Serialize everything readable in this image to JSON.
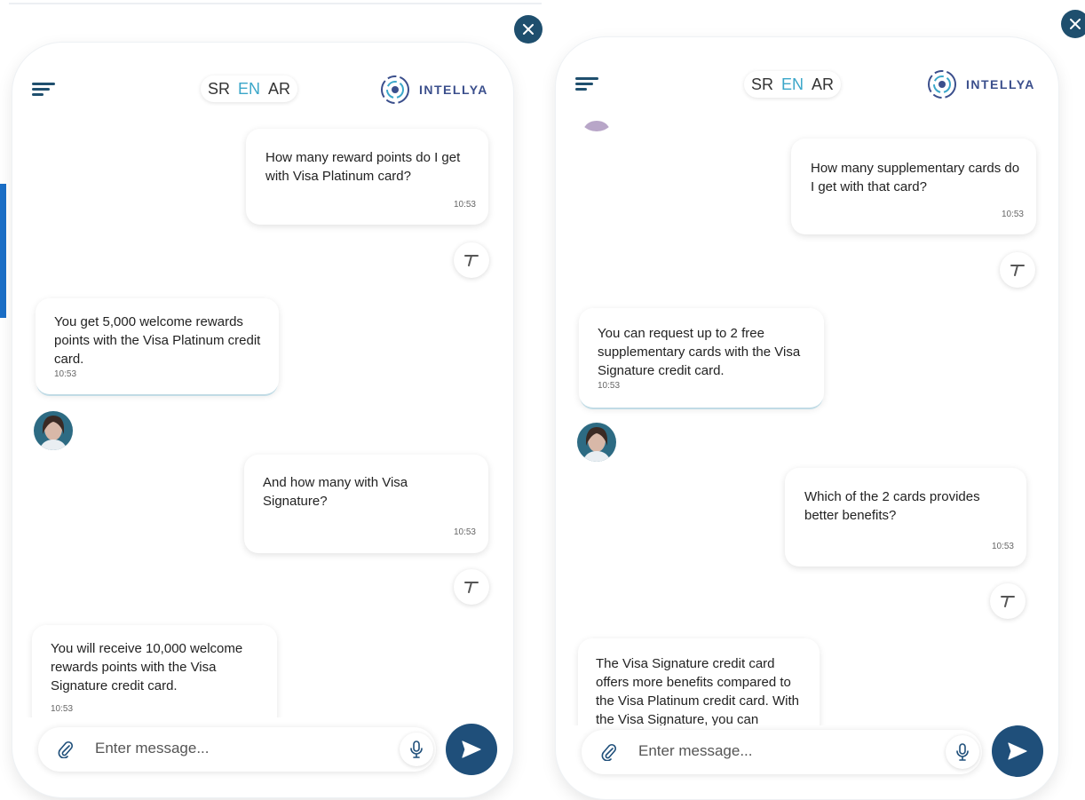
{
  "panels": [
    {
      "languages": [
        "SR",
        "EN",
        "AR"
      ],
      "active_language": "EN",
      "brand": "INTELLYA",
      "input_placeholder": "Enter message...",
      "messages": [
        {
          "role": "user",
          "text": "How many reward points do I get with Visa Platinum card?",
          "time": "10:53"
        },
        {
          "role": "bot",
          "text": "You get 5,000 welcome rewards points with the Visa Platinum credit card.",
          "time": "10:53"
        },
        {
          "role": "user",
          "text": "And how many with Visa Signature?",
          "time": "10:53"
        },
        {
          "role": "bot",
          "text": "You will receive 10,000 welcome rewards points with the Visa Signature credit card.",
          "time": "10:53"
        }
      ]
    },
    {
      "languages": [
        "SR",
        "EN",
        "AR"
      ],
      "active_language": "EN",
      "brand": "INTELLYA",
      "input_placeholder": "Enter message...",
      "messages": [
        {
          "role": "user",
          "text": "How many supplementary cards do I get with that card?",
          "time": "10:53"
        },
        {
          "role": "bot",
          "text": "You can request up to 2 free supplementary cards with the Visa Signature credit card.",
          "time": "10:53"
        },
        {
          "role": "user",
          "text": "Which of the 2 cards provides better benefits?",
          "time": "10:53"
        },
        {
          "role": "bot",
          "text": "The Visa Signature credit card offers more benefits compared to the Visa Platinum credit card. With the Visa Signature, you can",
          "time": ""
        }
      ]
    }
  ],
  "icons": {
    "close": "close-icon",
    "menu": "menu-icon",
    "brand_logo": "intellya-logo-icon",
    "tts": "text-to-speech-icon",
    "attach": "paperclip-icon",
    "mic": "microphone-icon",
    "send": "send-icon"
  },
  "colors": {
    "primary": "#1f4f7a",
    "accent": "#3aa6c9",
    "close_button": "#1f4f6e",
    "side_accent": "#1a6ec7"
  }
}
